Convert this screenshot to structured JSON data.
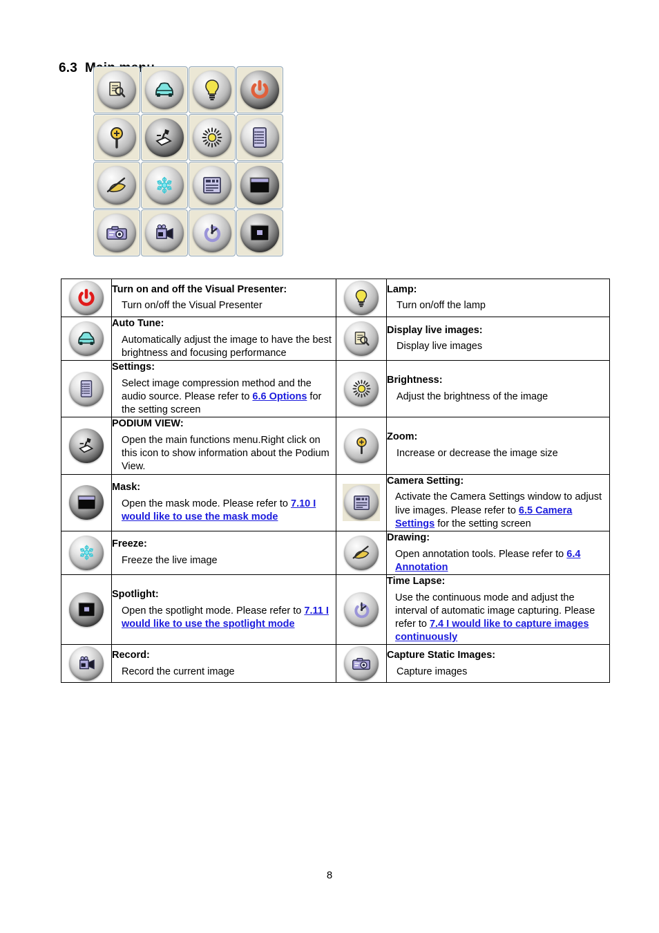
{
  "heading": {
    "number": "6.3",
    "title": "Main menu"
  },
  "icon_grid": {
    "rows": [
      [
        "display-live-images",
        "auto-tune",
        "lamp",
        "power"
      ],
      [
        "zoom",
        "podium-view",
        "brightness",
        "settings"
      ],
      [
        "drawing",
        "freeze",
        "camera-setting",
        "mask"
      ],
      [
        "capture-static-images",
        "record",
        "time-lapse",
        "spotlight"
      ]
    ]
  },
  "table": {
    "rows": [
      {
        "left": {
          "icon": "power-icon",
          "term": "Turn on and off the Visual Presenter:",
          "desc_pre": "Turn on/off the Visual Presenter",
          "link": "",
          "desc_post": ""
        },
        "right": {
          "icon": "lamp-icon",
          "term": "Lamp:",
          "desc_pre": "Turn on/off the lamp",
          "link": "",
          "desc_post": ""
        }
      },
      {
        "left": {
          "icon": "auto-tune-icon",
          "term": "Auto Tune:",
          "desc_pre": "Automatically adjust the image to have the best brightness and focusing performance",
          "link": "",
          "desc_post": ""
        },
        "right": {
          "icon": "display-live-images-icon",
          "term": "Display live images:",
          "desc_pre": "Display live images",
          "link": "",
          "desc_post": ""
        }
      },
      {
        "left": {
          "icon": "settings-icon",
          "term": "Settings:",
          "desc_pre": "Select image compression method and the audio source. Please refer to ",
          "link": "6.6 Options",
          "desc_post": " for the setting screen"
        },
        "right": {
          "icon": "brightness-icon",
          "term": "Brightness:",
          "desc_pre": "Adjust the brightness of the image",
          "link": "",
          "desc_post": ""
        }
      },
      {
        "left": {
          "icon": "podium-view-icon",
          "term": "PODIUM VIEW:",
          "desc_pre": "Open the main functions menu.Right click on this icon to show information about the Podium View.",
          "link": "",
          "desc_post": ""
        },
        "right": {
          "icon": "zoom-icon",
          "term": "Zoom:",
          "desc_pre": "Increase or decrease the image size",
          "link": "",
          "desc_post": ""
        }
      },
      {
        "left": {
          "icon": "mask-icon",
          "term": "Mask:",
          "desc_pre": "Open the mask mode. Please refer to ",
          "link": "7.10 I would like to use the mask mode",
          "desc_post": ""
        },
        "right": {
          "icon": "camera-setting-icon",
          "term": "Camera Setting:",
          "desc_pre": "Activate the Camera Settings window to adjust live images. Please refer to ",
          "link": "6.5 Camera Settings",
          "desc_post": " for the setting screen"
        }
      },
      {
        "left": {
          "icon": "freeze-icon",
          "term": "Freeze:",
          "desc_pre": "Freeze the live image",
          "link": "",
          "desc_post": ""
        },
        "right": {
          "icon": "drawing-icon",
          "term": "Drawing:",
          "desc_pre": "Open annotation tools. Please refer to ",
          "link": "6.4 Annotation",
          "desc_post": ""
        }
      },
      {
        "left": {
          "icon": "spotlight-icon",
          "term": "Spotlight:",
          "desc_pre": "Open the spotlight mode. Please refer to ",
          "link": "7.11 I would like to use the spotlight mode",
          "desc_post": ""
        },
        "right": {
          "icon": "time-lapse-icon",
          "term": "Time Lapse:",
          "desc_pre": "Use the continuous mode and adjust the interval of automatic image capturing. Please refer to ",
          "link": "7.4 I would like to capture images continuously",
          "desc_post": ""
        }
      },
      {
        "left": {
          "icon": "record-icon",
          "term": "Record:",
          "desc_pre": "Record the current image",
          "link": "",
          "desc_post": ""
        },
        "right": {
          "icon": "capture-static-images-icon",
          "term": "Capture Static Images:",
          "desc_pre": "Capture images",
          "link": "",
          "desc_post": ""
        }
      }
    ]
  },
  "footer": {
    "page_number": "8"
  },
  "colors": {
    "link": "#1c1cdd",
    "button_background": "#ebe7d5",
    "button_border": "#8fa5b8",
    "lamp_yellow": "#f2e44c",
    "power_orange": "#e0603c",
    "power_red": "#e01b1b",
    "auto_tune_cyan": "#7fe4e0",
    "freeze_cyan": "#4ad6e0",
    "drawing_gold": "#e8c84a",
    "mask_lavender": "#b3aee0",
    "record_lavender": "#a8a0d8"
  }
}
